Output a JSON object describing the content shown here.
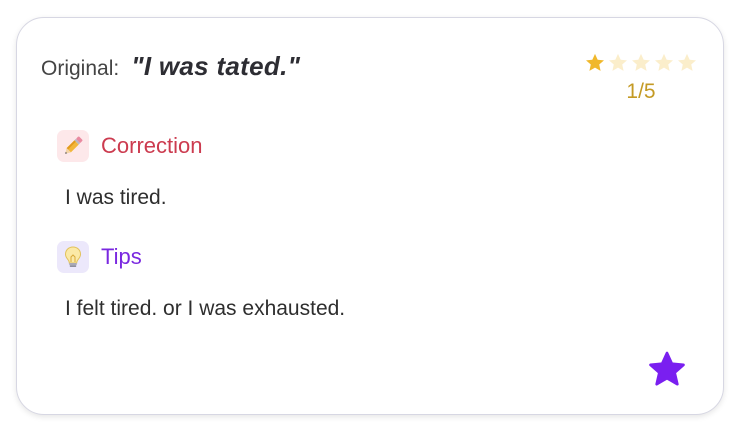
{
  "original": {
    "label": "Original:",
    "text": "\"I was tated.\""
  },
  "rating": {
    "value": 1,
    "max": 5,
    "text": "1/5",
    "filled_color": "#f0b82c",
    "empty_color": "#fbeecb"
  },
  "correction": {
    "icon": "pencil-icon",
    "label": "Correction",
    "text": "I was tired.",
    "color": "#cc3b4f"
  },
  "tips": {
    "icon": "lightbulb-icon",
    "label": "Tips",
    "text": "I felt tired. or I was exhausted.",
    "color": "#7a28e0"
  },
  "favorite": {
    "icon": "star-icon",
    "color": "#7a1ff0"
  }
}
